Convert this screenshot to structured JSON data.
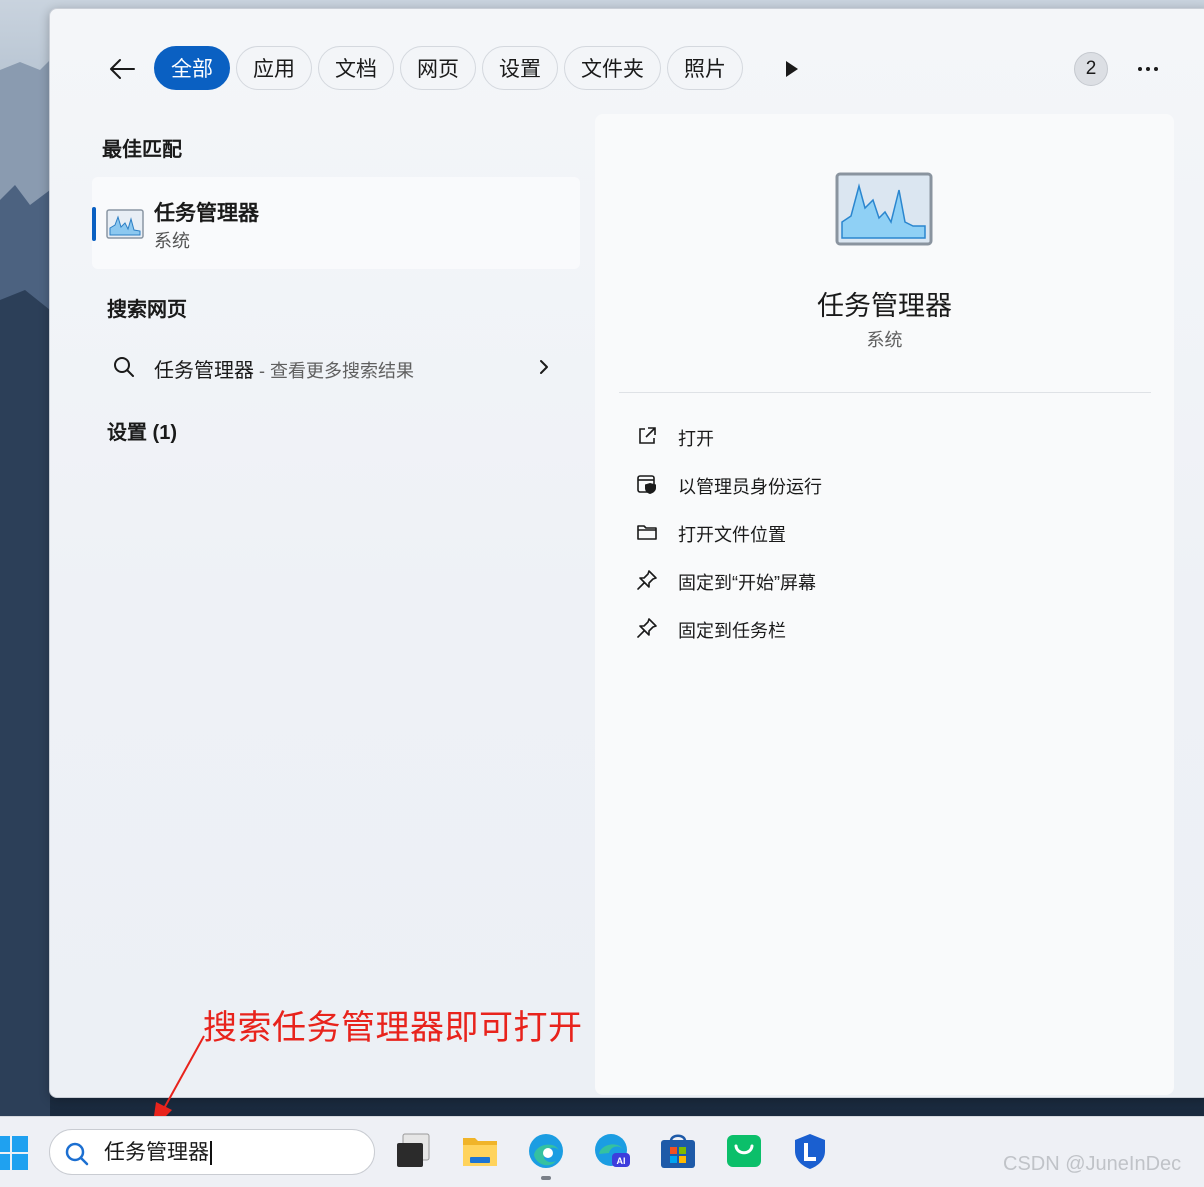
{
  "header": {
    "tabs": [
      {
        "label": "全部",
        "active": true
      },
      {
        "label": "应用"
      },
      {
        "label": "文档"
      },
      {
        "label": "网页"
      },
      {
        "label": "设置"
      },
      {
        "label": "文件夹"
      },
      {
        "label": "照片"
      }
    ],
    "badge_count": "2",
    "accent_color": "#0a60c2"
  },
  "left": {
    "best_match_title": "最佳匹配",
    "best_match": {
      "name": "任务管理器",
      "type": "系统",
      "icon": "task-manager-icon"
    },
    "web_search_title": "搜索网页",
    "web_search": {
      "query": "任务管理器",
      "suffix": " - 查看更多搜索结果"
    },
    "settings_title": "设置 (1)"
  },
  "detail": {
    "title": "任务管理器",
    "subtitle": "系统",
    "actions": [
      {
        "label": "打开",
        "icon": "open-external-icon"
      },
      {
        "label": "以管理员身份运行",
        "icon": "shield-admin-icon"
      },
      {
        "label": "打开文件位置",
        "icon": "folder-icon"
      },
      {
        "label": "固定到“开始”屏幕",
        "icon": "pin-icon"
      },
      {
        "label": "固定到任务栏",
        "icon": "pin-icon"
      }
    ]
  },
  "annotation": {
    "text": "搜索任务管理器即可打开",
    "color": "#e8231c"
  },
  "taskbar": {
    "search_value": "任务管理器",
    "icons": [
      "start-icon",
      "task-view-icon",
      "file-explorer-icon",
      "edge-icon",
      "edge-ai-icon",
      "microsoft-store-icon",
      "shopping-bag-icon",
      "security-shield-icon"
    ]
  },
  "watermark": "CSDN @JuneInDec"
}
